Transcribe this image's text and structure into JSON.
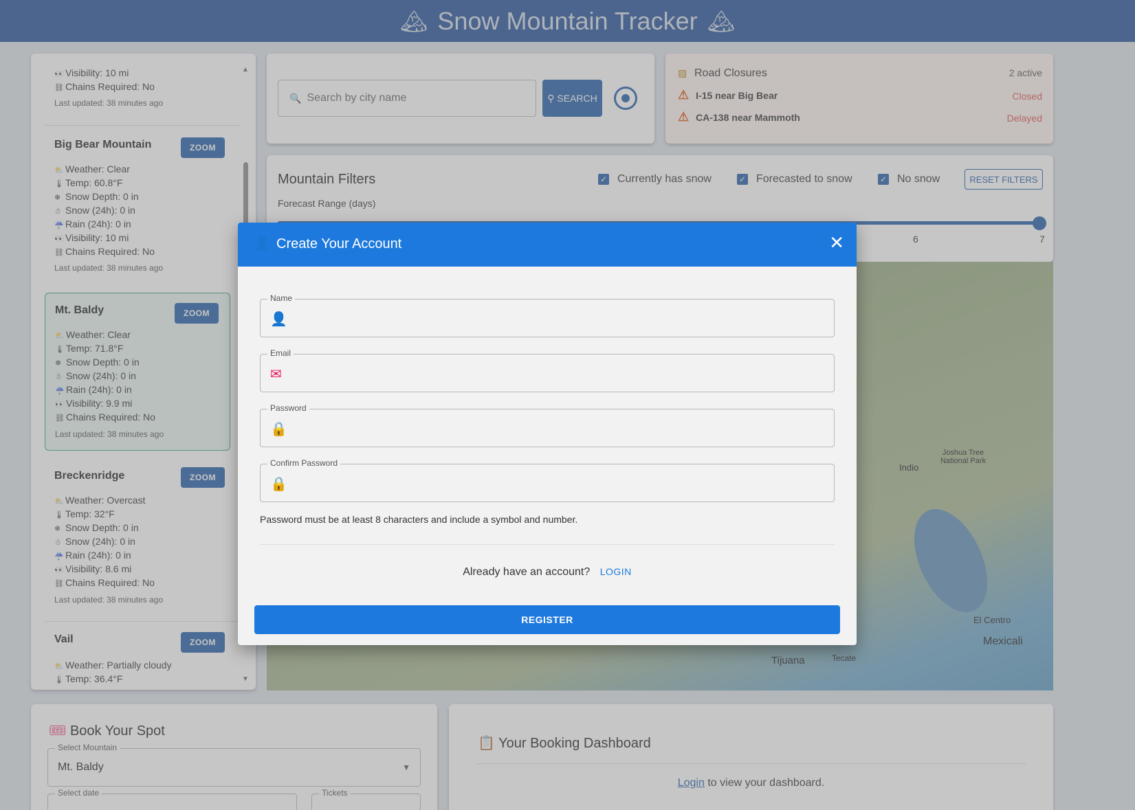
{
  "header": {
    "title": "Snow Mountain Tracker",
    "icon": "🏔"
  },
  "sidebar": {
    "top_partial": {
      "visibility": "Visibility: 10 mi",
      "chains": "Chains Required: No",
      "updated": "Last updated: 38 minutes ago"
    },
    "mountains": [
      {
        "name": "Big Bear Mountain",
        "zoom": "ZOOM",
        "weather": "Weather: Clear",
        "temp": "Temp: 60.8°F",
        "depth": "Snow Depth: 0 in",
        "snow24": "Snow (24h): 0 in",
        "rain24": "Rain (24h): 0 in",
        "visibility": "Visibility: 10 mi",
        "chains": "Chains Required: No",
        "updated": "Last updated: 38 minutes ago"
      },
      {
        "name": "Mt. Baldy",
        "zoom": "ZOOM",
        "weather": "Weather: Clear",
        "temp": "Temp: 71.8°F",
        "depth": "Snow Depth: 0 in",
        "snow24": "Snow (24h): 0 in",
        "rain24": "Rain (24h): 0 in",
        "visibility": "Visibility: 9.9 mi",
        "chains": "Chains Required: No",
        "updated": "Last updated: 38 minutes ago"
      },
      {
        "name": "Breckenridge",
        "zoom": "ZOOM",
        "weather": "Weather: Overcast",
        "temp": "Temp: 32°F",
        "depth": "Snow Depth: 0 in",
        "snow24": "Snow (24h): 0 in",
        "rain24": "Rain (24h): 0 in",
        "visibility": "Visibility: 8.6 mi",
        "chains": "Chains Required: No",
        "updated": "Last updated: 38 minutes ago"
      },
      {
        "name": "Vail",
        "zoom": "ZOOM",
        "weather": "Weather: Partially cloudy",
        "temp": "Temp: 36.4°F"
      }
    ]
  },
  "search": {
    "placeholder": "Search by city name",
    "button": "SEARCH"
  },
  "road_closures": {
    "title": "Road Closures",
    "count": "2 active",
    "items": [
      {
        "road": "I-15 near Big Bear",
        "status": "Closed"
      },
      {
        "road": "CA-138 near Mammoth",
        "status": "Delayed"
      }
    ]
  },
  "filters": {
    "title": "Mountain Filters",
    "options": [
      "Currently has snow",
      "Forecasted to snow",
      "No snow"
    ],
    "reset": "RESET FILTERS",
    "range_label": "Forecast Range (days)",
    "range_value": 7,
    "ticks": [
      "6",
      "7"
    ]
  },
  "map": {
    "places": [
      "Indio",
      "Joshua Tree National Park",
      "El Centro",
      "Mexicali",
      "Tijuana",
      "Tecate"
    ]
  },
  "modal": {
    "title": "Create Your Account",
    "fields": [
      {
        "label": "Name",
        "icon": "person-add-icon",
        "value": ""
      },
      {
        "label": "Email",
        "icon": "mail-icon",
        "value": ""
      },
      {
        "label": "Password",
        "icon": "lock-icon",
        "value": ""
      },
      {
        "label": "Confirm Password",
        "icon": "lock-icon",
        "value": ""
      }
    ],
    "hint": "Password must be at least 8 characters and include a symbol and number.",
    "have_account": "Already have an account?",
    "login": "LOGIN",
    "register": "REGISTER"
  },
  "booking": {
    "title": "Book Your Spot",
    "mountain_label": "Select Mountain",
    "mountain_value": "Mt. Baldy",
    "date_label": "Select date",
    "tickets_label": "Tickets"
  },
  "dashboard": {
    "title": "Your Booking Dashboard",
    "login_link": "Login",
    "login_text": " to view your dashboard."
  },
  "colors": {
    "primary": "#1f5ba8",
    "modal_header": "#1d79dd",
    "accent_icon": "#e8125b",
    "header": "#1f4f9a"
  }
}
